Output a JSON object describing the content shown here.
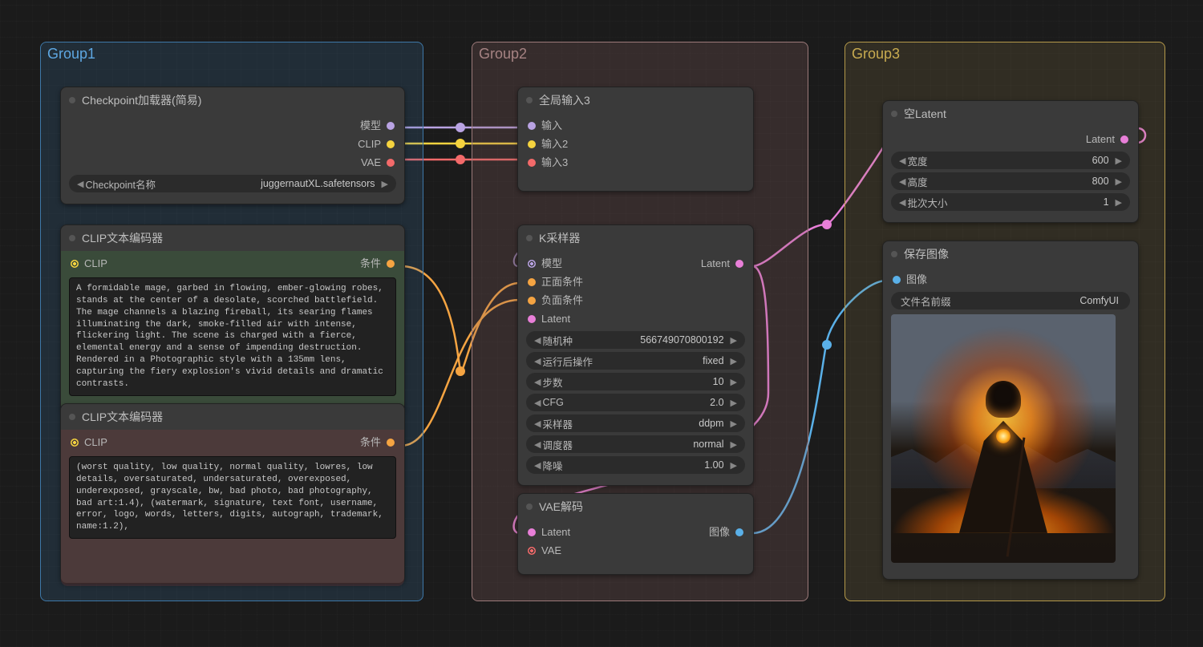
{
  "groups": {
    "g1": "Group1",
    "g2": "Group2",
    "g3": "Group3"
  },
  "checkpoint": {
    "title": "Checkpoint加载器(简易)",
    "out_model": "模型",
    "out_clip": "CLIP",
    "out_vae": "VAE",
    "widget_label": "Checkpoint名称",
    "widget_value": "juggernautXL.safetensors"
  },
  "clip_pos": {
    "title": "CLIP文本编码器",
    "in_clip": "CLIP",
    "out_cond": "条件",
    "text": "A formidable mage, garbed in flowing, ember-glowing robes, stands at the center of a desolate, scorched battlefield. The mage channels a blazing fireball, its searing flames illuminating the dark, smoke-filled air with intense, flickering light. The scene is charged with a fierce, elemental energy and a sense of impending destruction. Rendered in a Photographic style with a 135mm lens, capturing the fiery explosion's vivid details and dramatic contrasts."
  },
  "clip_neg": {
    "title": "CLIP文本编码器",
    "in_clip": "CLIP",
    "out_cond": "条件",
    "text": "(worst quality, low quality, normal quality, lowres, low details, oversaturated, undersaturated, overexposed, underexposed, grayscale, bw, bad photo, bad photography, bad art:1.4), (watermark, signature, text font, username, error, logo, words, letters, digits, autograph, trademark, name:1.2),"
  },
  "reroute": {
    "title": "全局输入3",
    "in1": "输入",
    "in2": "输入2",
    "in3": "输入3"
  },
  "ksampler": {
    "title": "K采样器",
    "in_model": "模型",
    "in_pos": "正面条件",
    "in_neg": "负面条件",
    "in_latent": "Latent",
    "out_latent": "Latent",
    "seed_label": "随机种",
    "seed_value": "566749070800192",
    "after_label": "运行后操作",
    "after_value": "fixed",
    "steps_label": "步数",
    "steps_value": "10",
    "cfg_label": "CFG",
    "cfg_value": "2.0",
    "sampler_label": "采样器",
    "sampler_value": "ddpm",
    "sched_label": "调度器",
    "sched_value": "normal",
    "denoise_label": "降噪",
    "denoise_value": "1.00"
  },
  "vae_decode": {
    "title": "VAE解码",
    "in_latent": "Latent",
    "in_vae": "VAE",
    "out_image": "图像"
  },
  "empty_latent": {
    "title": "空Latent",
    "out_latent": "Latent",
    "w_label": "宽度",
    "w_value": "600",
    "h_label": "高度",
    "h_value": "800",
    "b_label": "批次大小",
    "b_value": "1"
  },
  "save": {
    "title": "保存图像",
    "in_image": "图像",
    "prefix_label": "文件名前缀",
    "prefix_value": "ComfyUI"
  },
  "colors": {
    "model": "#b9a3e3",
    "clip": "#f5d33f",
    "vae": "#f36a6a",
    "cond": "#f5a442",
    "latent": "#e87fd8",
    "image": "#5ab0e8"
  }
}
